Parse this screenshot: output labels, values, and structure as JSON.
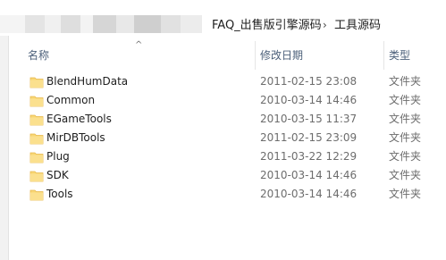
{
  "breadcrumb": {
    "segments": [
      "FAQ_出售版引擎源码",
      "工具源码"
    ],
    "separator": "›"
  },
  "columns": {
    "name": "名称",
    "modified": "修改日期",
    "type": "类型"
  },
  "files": [
    {
      "name": "BlendHumData",
      "modified": "2011-02-15 23:08",
      "type": "文件夹",
      "icon": "folder-icon"
    },
    {
      "name": "Common",
      "modified": "2010-03-14 14:46",
      "type": "文件夹",
      "icon": "folder-icon"
    },
    {
      "name": "EGameTools",
      "modified": "2010-03-15 11:37",
      "type": "文件夹",
      "icon": "folder-icon"
    },
    {
      "name": "MirDBTools",
      "modified": "2011-02-15 23:09",
      "type": "文件夹",
      "icon": "folder-icon"
    },
    {
      "name": "Plug",
      "modified": "2011-03-22 12:29",
      "type": "文件夹",
      "icon": "folder-icon"
    },
    {
      "name": "SDK",
      "modified": "2010-03-14 14:46",
      "type": "文件夹",
      "icon": "folder-icon"
    },
    {
      "name": "Tools",
      "modified": "2010-03-14 14:46",
      "type": "文件夹",
      "icon": "folder-icon"
    }
  ],
  "colors": {
    "folder": "#f8d775",
    "folder_dark": "#e8b84a",
    "header_text": "#4c607a"
  }
}
